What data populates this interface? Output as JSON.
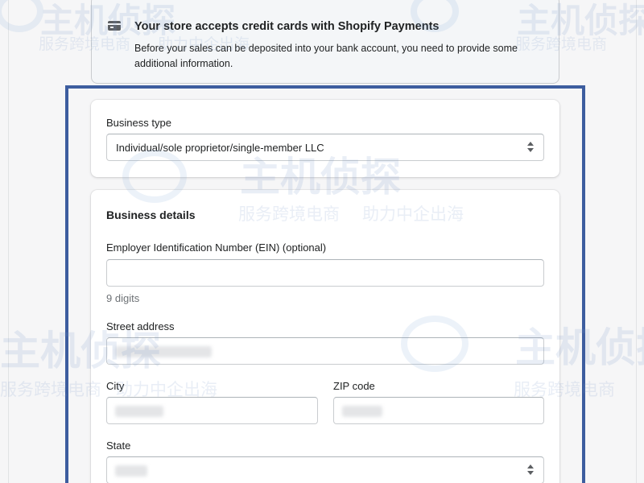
{
  "banner": {
    "icon": "credit-card-icon",
    "title": "Your store accepts credit cards with Shopify Payments",
    "text": "Before your sales can be deposited into your bank account, you need to provide some additional information."
  },
  "business_type": {
    "label": "Business type",
    "selected": "Individual/sole proprietor/single-member LLC"
  },
  "business_details": {
    "heading": "Business details",
    "ein": {
      "label": "Employer Identification Number (EIN) (optional)",
      "value": "",
      "help": "9 digits"
    },
    "street": {
      "label": "Street address",
      "value": ""
    },
    "city": {
      "label": "City",
      "value": ""
    },
    "zip": {
      "label": "ZIP code",
      "value": ""
    },
    "state": {
      "label": "State",
      "selected": ""
    }
  },
  "watermark": {
    "brand": "主机侦探",
    "slogan_left": "服务跨境电商",
    "slogan_right": "助力中企出海"
  },
  "colors": {
    "highlight_border": "#3d5d9f",
    "banner_bg": "#f4f6f8",
    "card_bg": "#ffffff",
    "page_bg": "#f6f6f7"
  }
}
